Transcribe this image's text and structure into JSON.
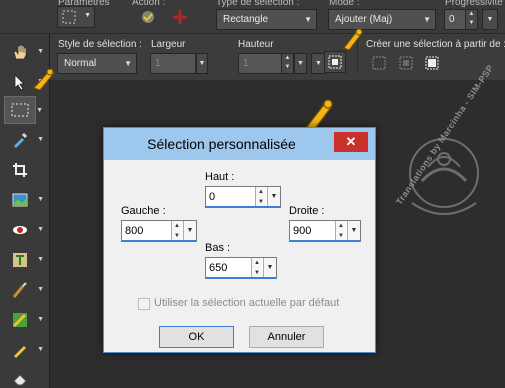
{
  "toolbar_top": {
    "label_presets": "Paramètres",
    "label_action": "Action :",
    "label_selection_type": "Type de sélection :",
    "label_mode": "Mode :",
    "label_progressive": "Progressivité",
    "selection_type_value": "Rectangle",
    "mode_value": "Ajouter (Maj)",
    "progressive_value": "0"
  },
  "toolbar_second": {
    "label_style": "Style de sélection :",
    "label_width": "Largeur",
    "label_height": "Hauteur",
    "label_create_from": "Créer une sélection à partir de :",
    "style_value": "Normal",
    "width_value": "1",
    "height_value": "1"
  },
  "left_tools": [
    {
      "name": "pan-tool",
      "icon": "hand-icon"
    },
    {
      "name": "pick-tool",
      "icon": "arrow-pointer-icon"
    },
    {
      "name": "selection-tool",
      "icon": "marquee-selection-icon",
      "selected": true
    },
    {
      "name": "dropper-tool",
      "icon": "eyedropper-icon"
    },
    {
      "name": "crop-tool",
      "icon": "crop-icon"
    },
    {
      "name": "straighten-tool",
      "icon": "photo-straighten-icon"
    },
    {
      "name": "red-eye-tool",
      "icon": "eye-icon"
    },
    {
      "name": "text-tool",
      "icon": "text-t-icon"
    },
    {
      "name": "paint-brush-tool",
      "icon": "brush-icon"
    },
    {
      "name": "color-replacer-tool",
      "icon": "color-replacer-icon"
    },
    {
      "name": "warp-brush-tool",
      "icon": "pencil-icon"
    },
    {
      "name": "eraser-tool",
      "icon": "eraser-icon"
    }
  ],
  "dialog": {
    "title": "Sélection personnalisée",
    "close_symbol": "✕",
    "top_label": "Haut :",
    "top_value": "0",
    "left_label": "Gauche :",
    "left_value": "800",
    "right_label": "Droite :",
    "right_value": "900",
    "bottom_label": "Bas :",
    "bottom_value": "650",
    "checkbox_label": "Utiliser la  sélection actuelle par défaut",
    "ok_label": "OK",
    "cancel_label": "Annuler"
  },
  "watermark": {
    "text": "Translations by Marcinha - SIM-PSP"
  },
  "colors": {
    "pointer": "#f2b516",
    "dialog_title_bg": "#9ec7ee",
    "close_bg": "#c9302c",
    "accent_blue": "#3c7fd4"
  }
}
